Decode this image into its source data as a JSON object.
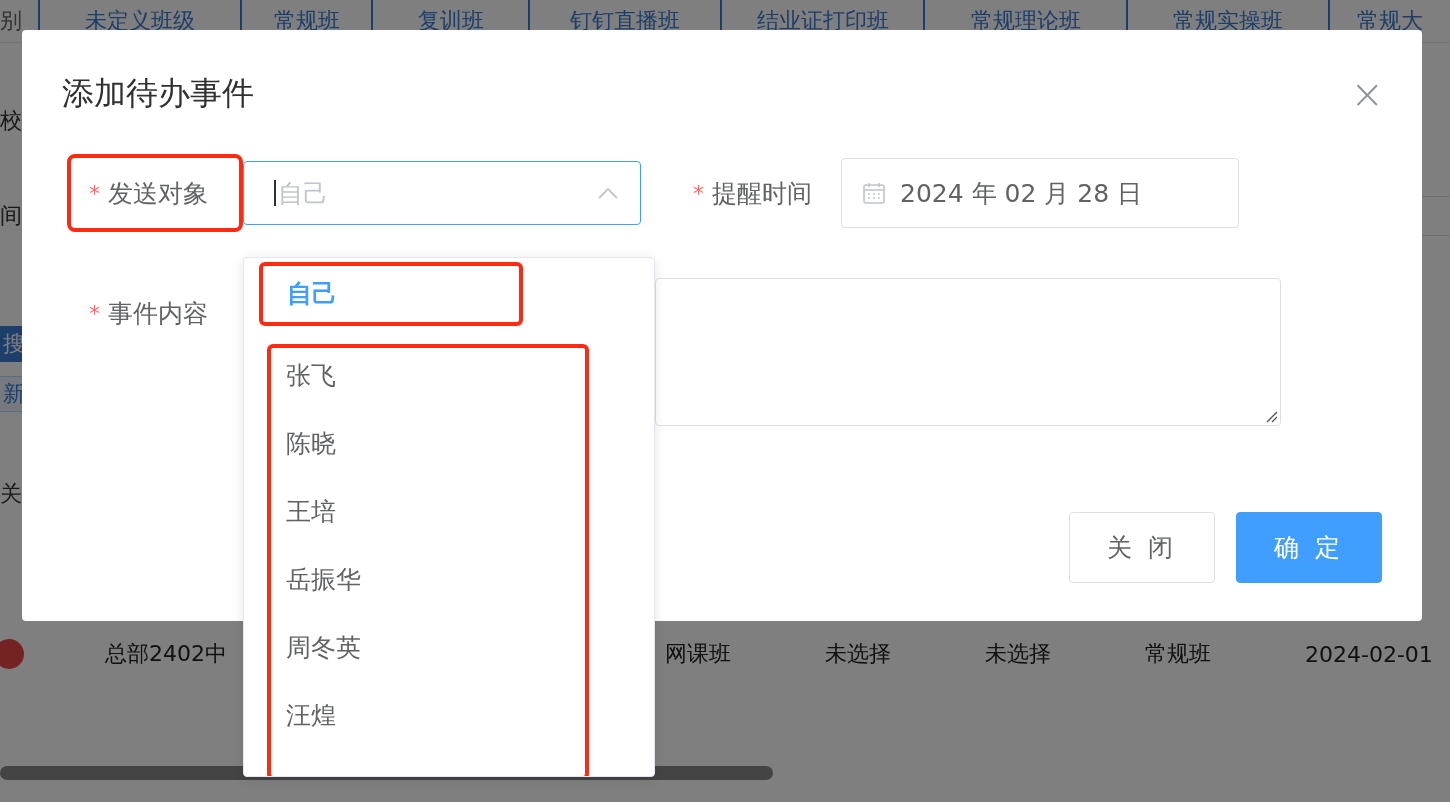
{
  "background": {
    "tabs": [
      {
        "label": "别",
        "kind": "label"
      },
      {
        "label": "未定义班级",
        "kind": "tab"
      },
      {
        "label": "常规班",
        "kind": "tab"
      },
      {
        "label": "复训班",
        "kind": "tab"
      },
      {
        "label": "钉钉直播班",
        "kind": "tab"
      },
      {
        "label": "结业证打印班",
        "kind": "tab"
      },
      {
        "label": "常规理论班",
        "kind": "tab"
      },
      {
        "label": "常规实操班",
        "kind": "tab"
      },
      {
        "label": "常规大",
        "kind": "tab"
      }
    ],
    "side_labels": [
      "校",
      "间"
    ],
    "buttons": [
      {
        "label": "搜",
        "kind": "primary"
      },
      {
        "label": "新",
        "kind": "plain"
      }
    ],
    "footer_label": "关",
    "row": {
      "cells": [
        "总部2402中",
        "网课班",
        "未选择",
        "未选择",
        "常规班",
        "2024-02-01"
      ]
    }
  },
  "dialog": {
    "title": "添加待办事件",
    "close": "×",
    "required_mark": "*",
    "send_to": {
      "label": "发送对象",
      "required": true,
      "highlighted": true,
      "placeholder": "自己",
      "open": true
    },
    "remind_time": {
      "label": "提醒时间",
      "required": true,
      "value": "2024 年 02 月 28 日"
    },
    "content": {
      "label": "事件内容",
      "required": true
    },
    "buttons": [
      {
        "label": "关 闭",
        "kind": "plain"
      },
      {
        "label": "确 定",
        "kind": "primary"
      }
    ]
  },
  "dropdown": {
    "group_highlighted": true,
    "options": [
      {
        "label": "自己",
        "selected": true,
        "highlighted": true
      },
      {
        "label": "张飞",
        "selected": false,
        "highlighted": false
      },
      {
        "label": "陈晓",
        "selected": false,
        "highlighted": false
      },
      {
        "label": "王培",
        "selected": false,
        "highlighted": false
      },
      {
        "label": "岳振华",
        "selected": false,
        "highlighted": false
      },
      {
        "label": "周冬英",
        "selected": false,
        "highlighted": false
      },
      {
        "label": "汪煌",
        "selected": false,
        "highlighted": false
      }
    ]
  }
}
